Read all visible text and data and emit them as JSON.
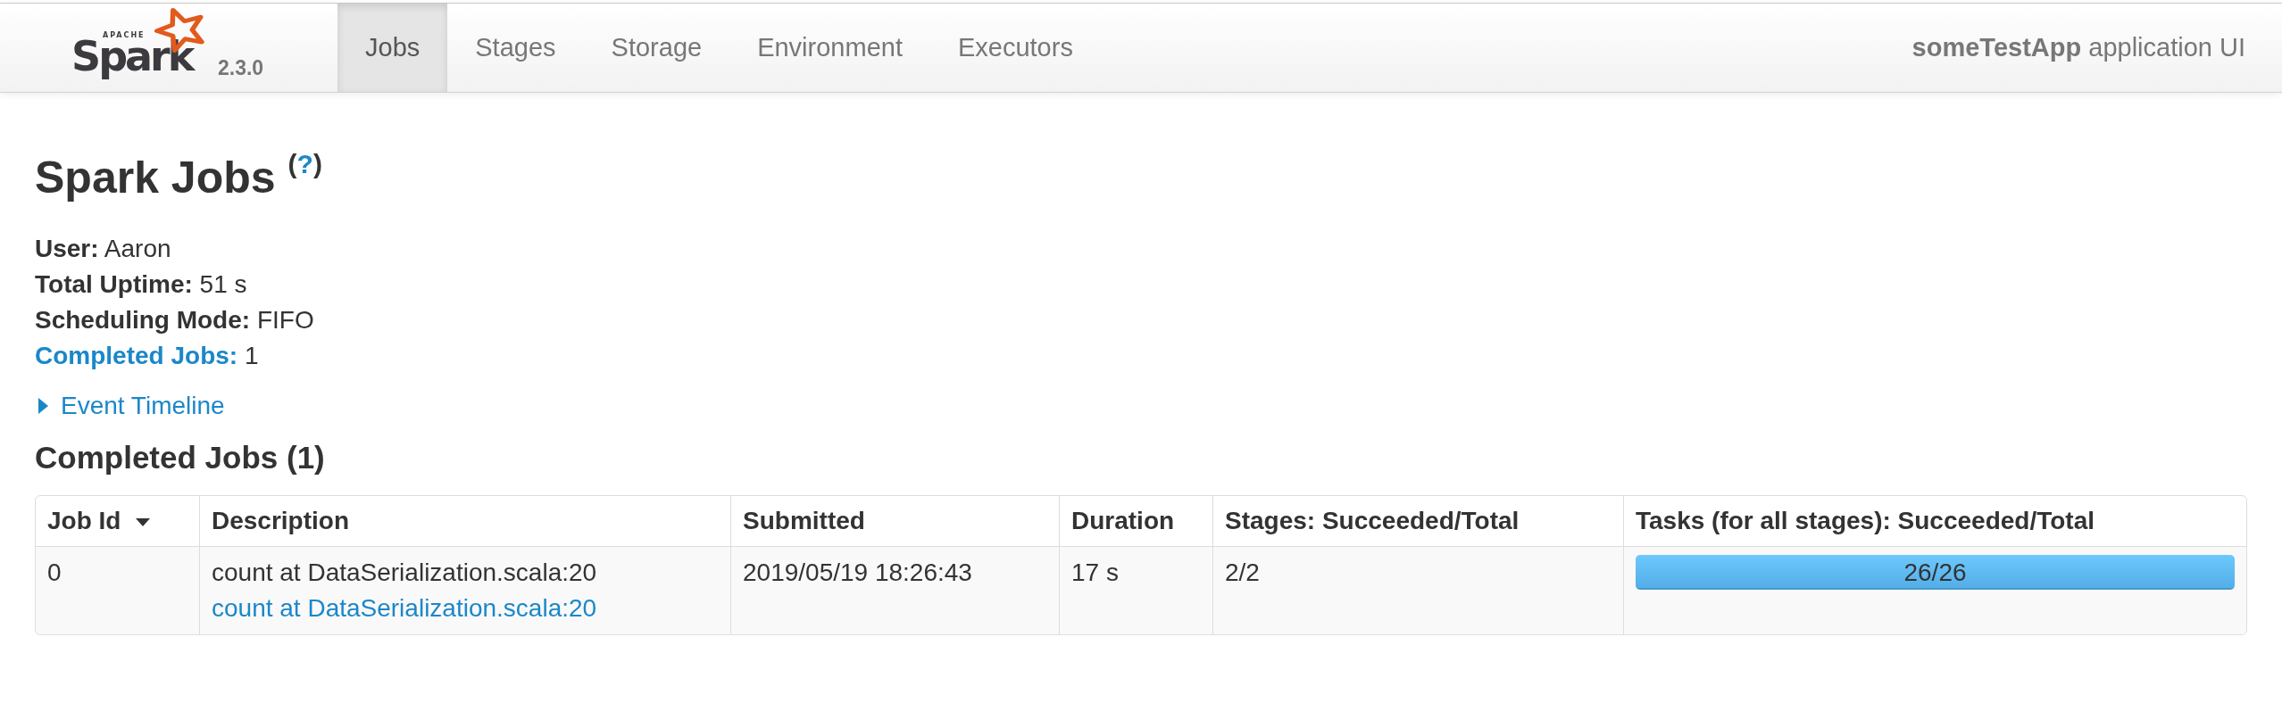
{
  "navbar": {
    "logo": {
      "tagline": "APACHE",
      "wordmark": "Spark"
    },
    "version": "2.3.0",
    "tabs": [
      {
        "label": "Jobs",
        "selected": true
      },
      {
        "label": "Stages",
        "selected": false
      },
      {
        "label": "Storage",
        "selected": false
      },
      {
        "label": "Environment",
        "selected": false
      },
      {
        "label": "Executors",
        "selected": false
      }
    ],
    "app_title": "**someTestApp** application UI"
  },
  "page": {
    "title": "Spark Jobs",
    "help_link": {
      "open": "(",
      "label": "?",
      "close": ")"
    },
    "summary": [
      {
        "kind": "text",
        "label": "User:",
        "value": "Aaron"
      },
      {
        "kind": "text",
        "label": "Total Uptime:",
        "value": "51 s"
      },
      {
        "kind": "text",
        "label": "Scheduling Mode:",
        "value": "FIFO"
      },
      {
        "kind": "link",
        "label": "Completed Jobs:",
        "value": "1"
      }
    ],
    "event_timeline": {
      "label": "Event Timeline",
      "expanded": false
    },
    "section_title": "Completed Jobs (1)"
  },
  "table": {
    "columns": [
      {
        "label": "Job Id",
        "sorted": true
      },
      {
        "label": "Description",
        "sorted": false
      },
      {
        "label": "Submitted",
        "sorted": false
      },
      {
        "label": "Duration",
        "sorted": false
      },
      {
        "label": "Stages: Succeeded/Total",
        "sorted": false
      },
      {
        "label": "Tasks (for all stages): Succeeded/Total",
        "sorted": false
      }
    ],
    "rows": [
      {
        "job_id": "0",
        "description": {
          "text": "count at DataSerialization.scala:20",
          "link": "count at DataSerialization.scala:20"
        },
        "submitted": "2019/05/19 18:26:43",
        "duration": "17 s",
        "stages": "2/2",
        "tasks": {
          "label": "26/26",
          "level": 1
        }
      }
    ]
  }
}
